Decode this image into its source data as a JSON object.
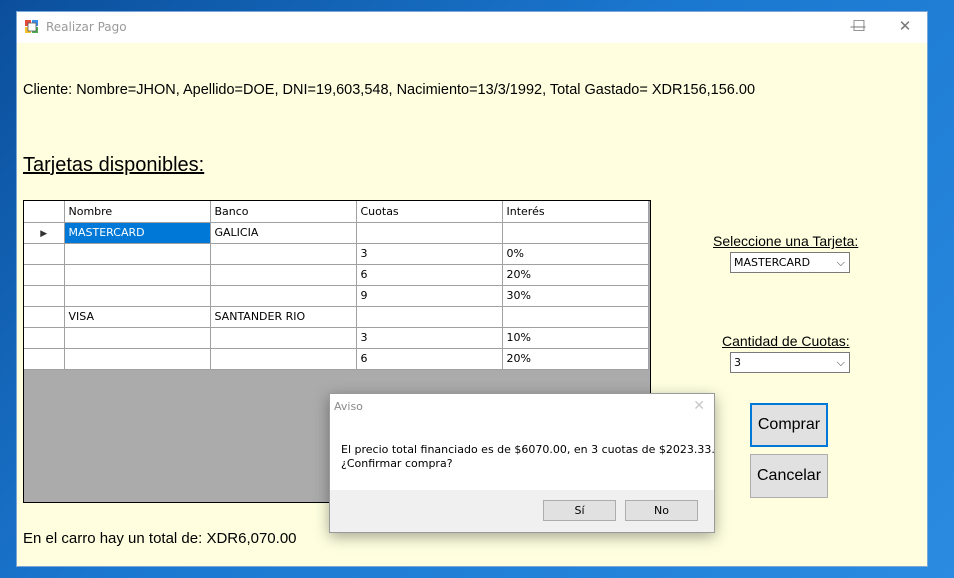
{
  "window": {
    "title": "Realizar Pago",
    "controls": {
      "minimize": "—",
      "maximize": "☐",
      "close": "✕"
    }
  },
  "client_info": "Cliente: Nombre=JHON, Apellido=DOE, DNI=19,603,548, Nacimiento=13/3/1992, Total Gastado= XDR156,156.00",
  "section_title": "Tarjetas disponibles:",
  "grid": {
    "columns": [
      "Nombre",
      "Banco",
      "Cuotas",
      "Interés"
    ],
    "rows": [
      {
        "nombre": "MASTERCARD",
        "banco": "GALICIA",
        "cuotas": "",
        "interes": "",
        "current": true
      },
      {
        "nombre": "",
        "banco": "",
        "cuotas": "3",
        "interes": "0%"
      },
      {
        "nombre": "",
        "banco": "",
        "cuotas": "6",
        "interes": "20%"
      },
      {
        "nombre": "",
        "banco": "",
        "cuotas": "9",
        "interes": "30%"
      },
      {
        "nombre": "VISA",
        "banco": "SANTANDER RIO",
        "cuotas": "",
        "interes": ""
      },
      {
        "nombre": "",
        "banco": "",
        "cuotas": "3",
        "interes": "10%"
      },
      {
        "nombre": "",
        "banco": "",
        "cuotas": "6",
        "interes": "20%"
      }
    ]
  },
  "card_select": {
    "label": "Seleccione una Tarjeta:",
    "value": "MASTERCARD"
  },
  "installments_select": {
    "label": "Cantidad de Cuotas:",
    "value": "3"
  },
  "buttons": {
    "buy": "Comprar",
    "cancel": "Cancelar"
  },
  "cart_total": "En el carro hay un total de: XDR6,070.00",
  "dialog": {
    "title": "Aviso",
    "message_line1": "El precio total financiado es de $6070.00, en 3 cuotas de $2023.33.",
    "message_line2": "¿Confirmar compra?",
    "yes": "Sí",
    "no": "No"
  },
  "colors": {
    "window_bg": "#ffffe0",
    "selection": "#0078d7",
    "grid_empty": "#ababab"
  }
}
